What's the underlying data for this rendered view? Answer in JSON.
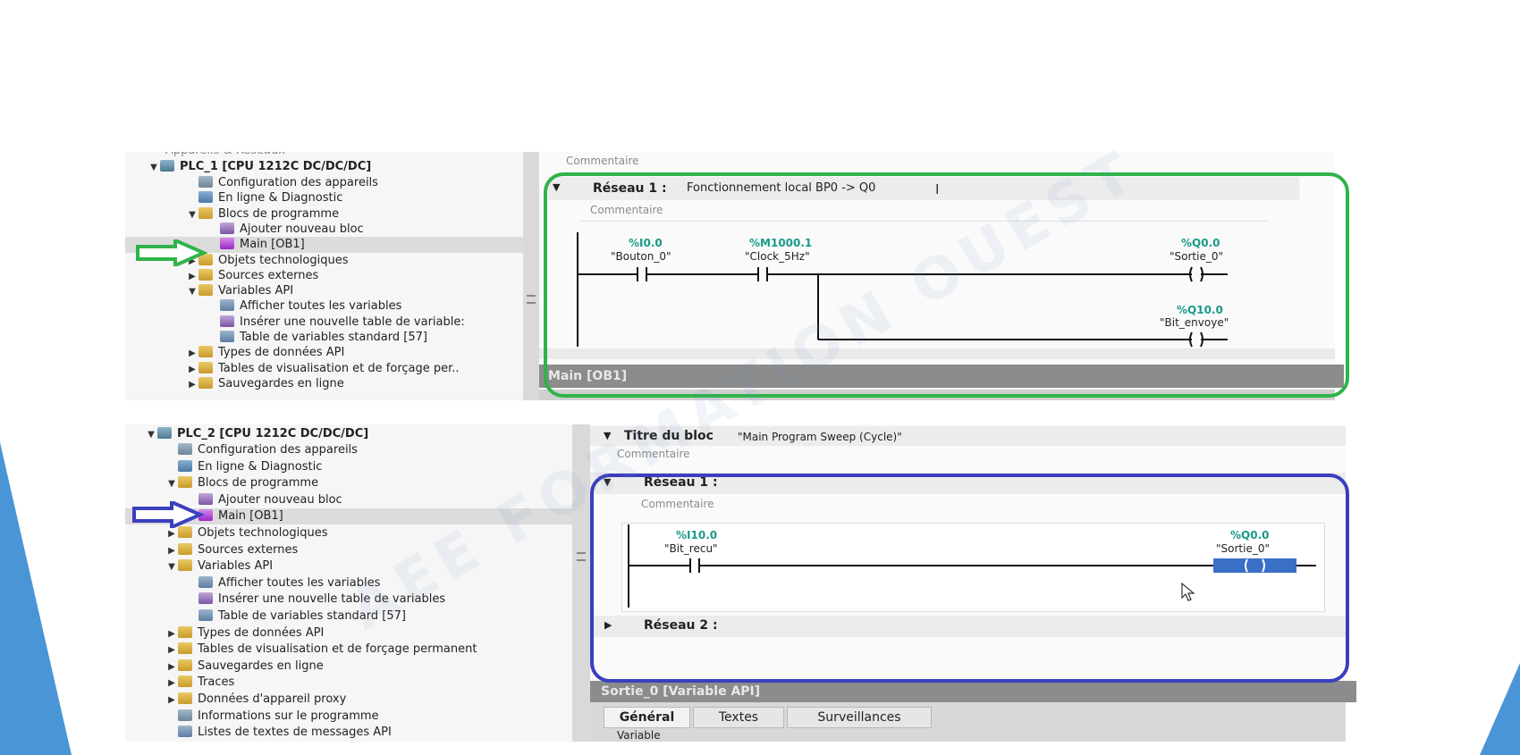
{
  "colors": {
    "green_frame": "#2fb34a",
    "blue_frame": "#3b3fbf",
    "triangle_blue": "#4a95d6"
  },
  "top": {
    "tree": {
      "partial_top": "Appareils & Réseaux",
      "plc": "PLC_1 [CPU 1212C DC/DC/DC]",
      "items": [
        {
          "label": "Configuration des appareils",
          "icon": "config-icon"
        },
        {
          "label": "En ligne & Diagnostic",
          "icon": "online-icon"
        },
        {
          "label": "Blocs de programme",
          "icon": "folder-icon"
        },
        {
          "label": "Ajouter nouveau bloc",
          "icon": "add-block-icon"
        },
        {
          "label": "Main [OB1]",
          "icon": "main-block-icon"
        },
        {
          "label": "Objets technologiques",
          "icon": "folder-icon"
        },
        {
          "label": "Sources externes",
          "icon": "folder-icon"
        },
        {
          "label": "Variables API",
          "icon": "folder-icon"
        },
        {
          "label": "Afficher toutes les variables",
          "icon": "variables-icon"
        },
        {
          "label": "Insérer une nouvelle table de variable:",
          "icon": "add-table-icon"
        },
        {
          "label": "Table de variables standard [57]",
          "icon": "table-icon"
        },
        {
          "label": "Types de données API",
          "icon": "folder-icon"
        },
        {
          "label": "Tables de visualisation et de forçage per..",
          "icon": "folder-icon"
        },
        {
          "label": "Sauvegardes en ligne",
          "icon": "folder-icon"
        }
      ]
    },
    "editor": {
      "comment_top": "Commentaire",
      "network_label": "Réseau 1 :",
      "network_title": "Fonctionnement local BP0 -> Q0",
      "network_comment": "Commentaire",
      "contact1": {
        "addr": "%I0.0",
        "tag": "\"Bouton_0\""
      },
      "contact2": {
        "addr": "%M1000.1",
        "tag": "\"Clock_5Hz\""
      },
      "coil1": {
        "addr": "%Q0.0",
        "tag": "\"Sortie_0\""
      },
      "coil2": {
        "addr": "%Q10.0",
        "tag": "\"Bit_envoye\""
      },
      "footer_title": "Main [OB1]"
    }
  },
  "bottom": {
    "tree": {
      "plc": "PLC_2 [CPU 1212C DC/DC/DC]",
      "items": [
        {
          "label": "Configuration des appareils",
          "icon": "config-icon"
        },
        {
          "label": "En ligne & Diagnostic",
          "icon": "online-icon"
        },
        {
          "label": "Blocs de programme",
          "icon": "folder-icon"
        },
        {
          "label": "Ajouter nouveau bloc",
          "icon": "add-block-icon"
        },
        {
          "label": "Main [OB1]",
          "icon": "main-block-icon"
        },
        {
          "label": "Objets technologiques",
          "icon": "folder-icon"
        },
        {
          "label": "Sources externes",
          "icon": "folder-icon"
        },
        {
          "label": "Variables API",
          "icon": "folder-icon"
        },
        {
          "label": "Afficher toutes les variables",
          "icon": "variables-icon"
        },
        {
          "label": "Insérer une nouvelle table de variables",
          "icon": "add-table-icon"
        },
        {
          "label": "Table de variables standard [57]",
          "icon": "table-icon"
        },
        {
          "label": "Types de données API",
          "icon": "folder-icon"
        },
        {
          "label": "Tables de visualisation et de forçage permanent",
          "icon": "folder-icon"
        },
        {
          "label": "Sauvegardes en ligne",
          "icon": "folder-icon"
        },
        {
          "label": "Traces",
          "icon": "folder-icon"
        },
        {
          "label": "Données d'appareil proxy",
          "icon": "folder-icon"
        },
        {
          "label": "Informations sur le programme",
          "icon": "info-icon"
        },
        {
          "label": "Listes de textes de messages API",
          "icon": "text-list-icon"
        }
      ]
    },
    "editor": {
      "block_title_label": "Titre du bloc",
      "block_title": "\"Main Program Sweep (Cycle)\"",
      "block_comment": "Commentaire",
      "network1_label": "Réseau 1 :",
      "network1_comment": "Commentaire",
      "contact": {
        "addr": "%I10.0",
        "tag": "\"Bit_recu\""
      },
      "coil": {
        "addr": "%Q0.0",
        "tag": "\"Sortie_0\""
      },
      "network2_label": "Réseau 2 :",
      "footer_title": "Sortie_0 [Variable API]",
      "tabs": [
        "Général",
        "Textes",
        "Surveillances"
      ],
      "partial_field": "Variable"
    }
  },
  "watermark": "AEE FORMATION OUEST"
}
